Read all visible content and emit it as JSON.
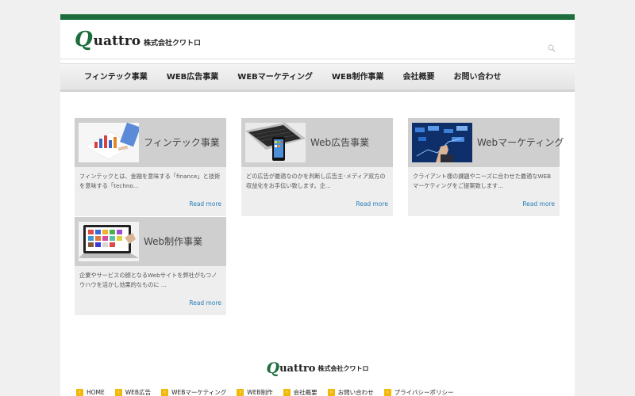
{
  "header": {
    "logo_q": "Q",
    "logo_word": "uattro",
    "logo_corp": "株式会社クワトロ"
  },
  "nav": {
    "items": [
      "フィンテック事業",
      "WEB広告事業",
      "WEBマーケティング",
      "WEB制作事業",
      "会社概要",
      "お問い合わせ"
    ]
  },
  "cards": [
    {
      "title": "フィンテック事業",
      "desc": "フィンテックとは、金融を意味する「finance」と技術を意味する「techno...",
      "link": "Read more"
    },
    {
      "title": "Web広告事業",
      "desc": "どの広告が最適なのかを判断し広告主･メディア双方の収益化をお手伝い致します。企...",
      "link": "Read more"
    },
    {
      "title": "Webマーケティング",
      "desc": "クライアント様の課題やニーズに合わせた最適なWEBマーケティングをご提案致します...",
      "link": "Read more"
    },
    {
      "title": "Web制作事業",
      "desc": "企業やサービスの顔となるWebサイトを弊社がもつノウハウを活かし効果的なものに ...",
      "link": "Read more"
    }
  ],
  "footer": {
    "logo_q": "Q",
    "logo_word": "uattro",
    "logo_corp": "株式会社クワトロ",
    "arrow": "›",
    "links": [
      "HOME",
      "WEB広告",
      "WEBマーケティング",
      "WEB制作",
      "会社概要",
      "お問い合わせ",
      "プライバシーポリシー"
    ]
  },
  "colors": {
    "brand_green": "#1d6e3c",
    "link_blue": "#2a7fb8",
    "footer_arrow": "#f1b90a"
  }
}
